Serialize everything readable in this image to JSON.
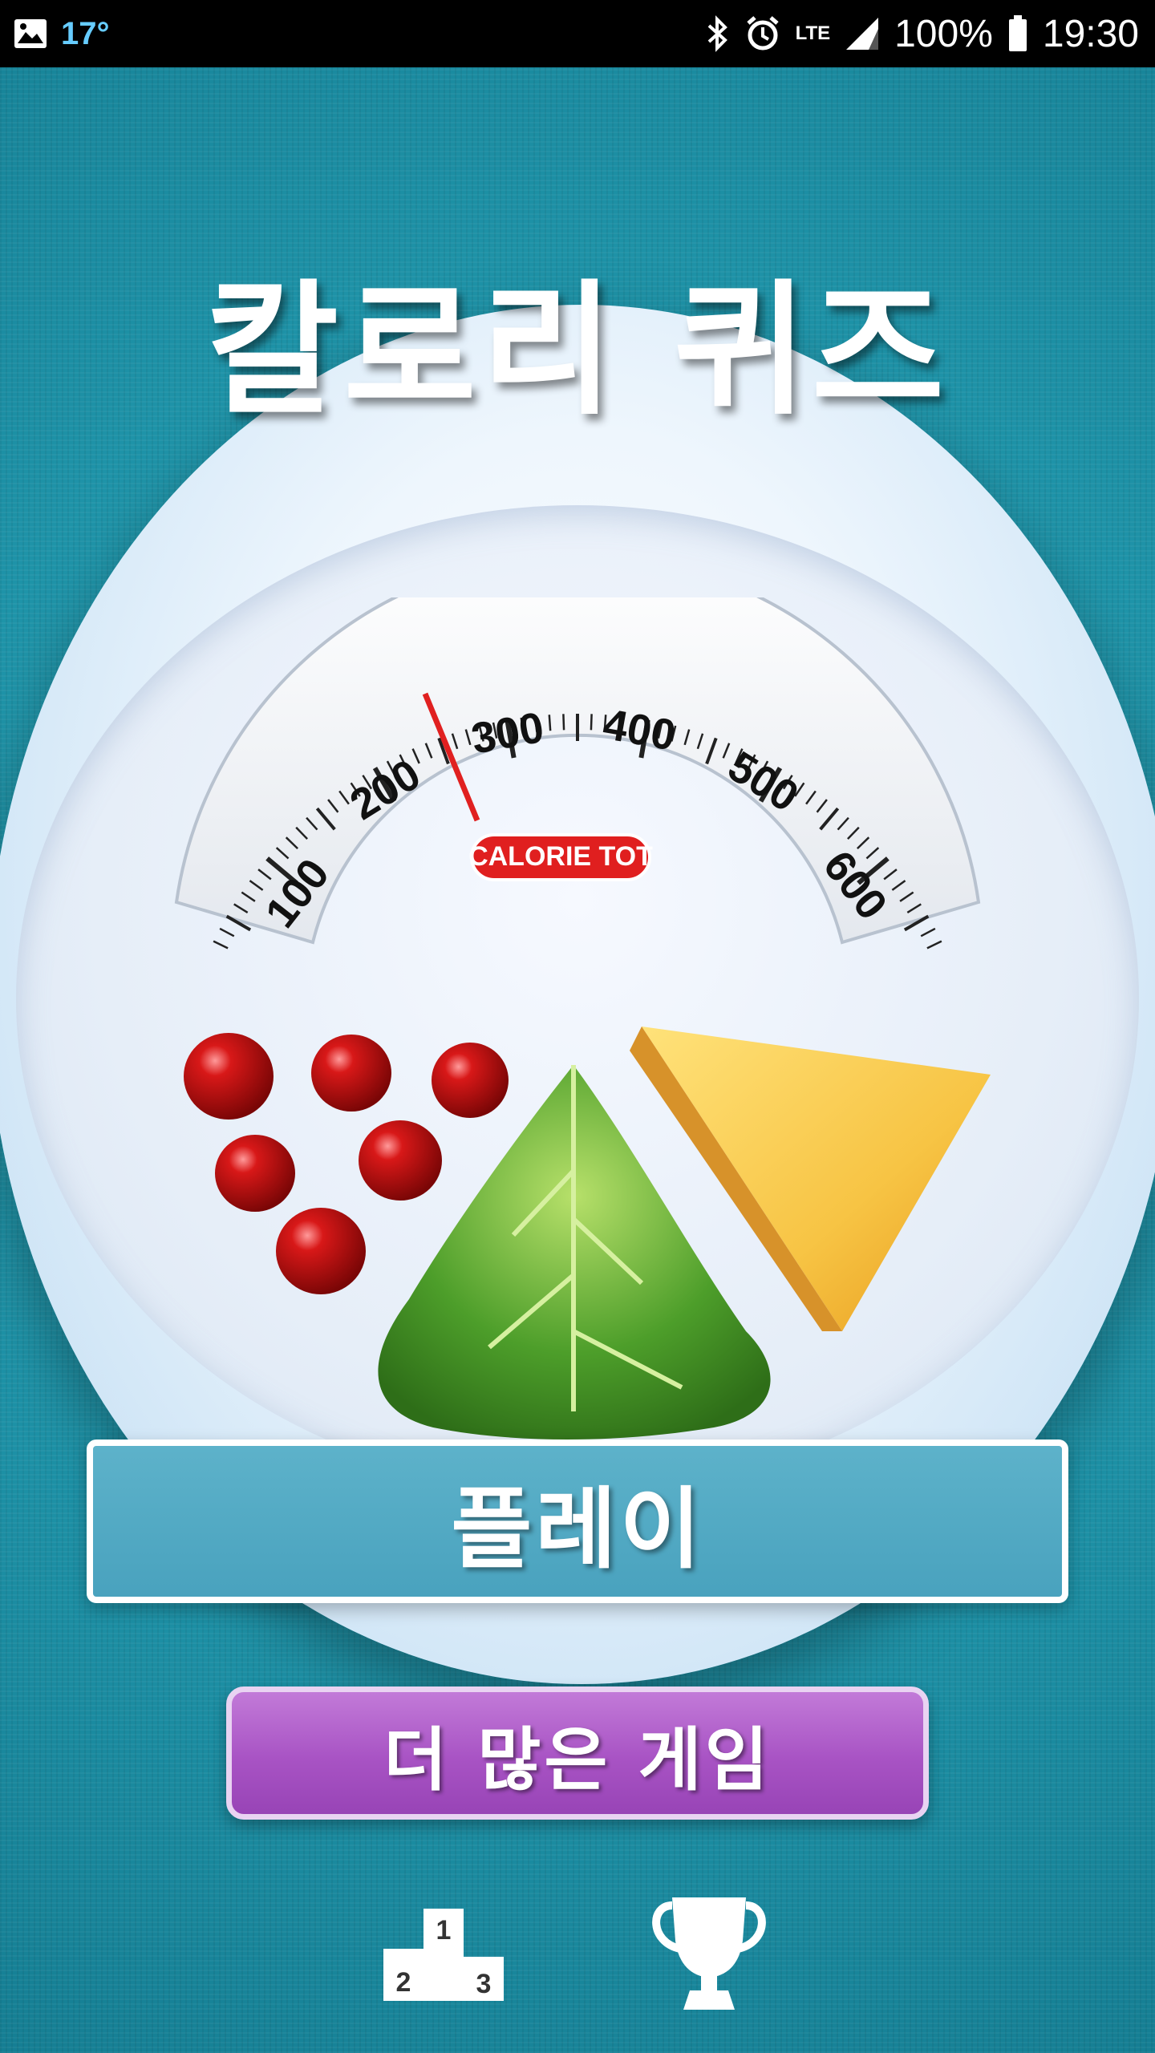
{
  "status_bar": {
    "temperature": "17°",
    "network": "LTE",
    "battery": "100%",
    "time": "19:30"
  },
  "app": {
    "title": "칼로리 퀴즈",
    "gauge_label": "CALORIE TOT",
    "gauge_ticks": [
      "100",
      "200",
      "300",
      "400",
      "500",
      "600"
    ],
    "play_button": "플레이",
    "more_games_button": "더 많은 게임",
    "podium_numbers": [
      "1",
      "2",
      "3"
    ]
  },
  "colors": {
    "background": "#1b8fa3",
    "play_button": "#52a9c4",
    "more_button": "#a853c4",
    "gauge_needle": "#e02020"
  },
  "icons": {
    "status_left": "image-icon",
    "bottom_left": "leaderboard-podium-icon",
    "bottom_right": "trophy-icon"
  }
}
